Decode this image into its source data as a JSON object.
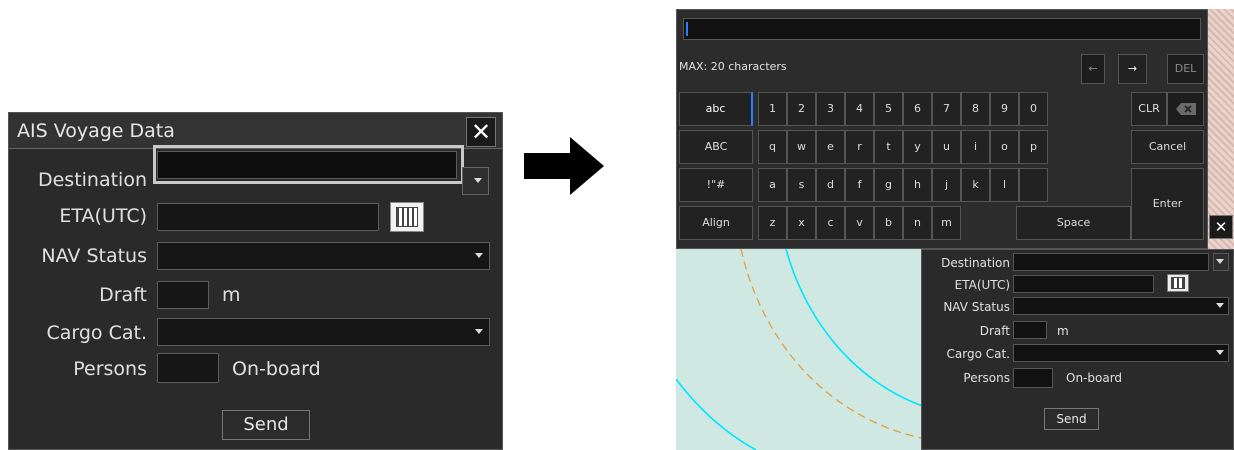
{
  "left_dialog": {
    "title": "AIS Voyage Data",
    "close_icon": "close-icon",
    "labels": {
      "destination": "Destination",
      "eta": "ETA(UTC)",
      "nav_status": "NAV Status",
      "draft": "Draft",
      "cargo": "Cargo Cat.",
      "persons": "Persons"
    },
    "units": {
      "draft": "m",
      "persons": "On-board"
    },
    "send_label": "Send"
  },
  "keyboard": {
    "max_text": "MAX: 20 characters",
    "left_arrow": "←",
    "right_arrow": "→",
    "del": "DEL",
    "clr": "CLR",
    "backspace_icon": "backspace-icon",
    "mode_keys": [
      "abc",
      "ABC",
      "!\"#",
      "Align"
    ],
    "row1": [
      "1",
      "2",
      "3",
      "4",
      "5",
      "6",
      "7",
      "8",
      "9",
      "0"
    ],
    "row2": [
      "q",
      "w",
      "e",
      "r",
      "t",
      "y",
      "u",
      "i",
      "o",
      "p"
    ],
    "row3": [
      "a",
      "s",
      "d",
      "f",
      "g",
      "h",
      "j",
      "k",
      "l"
    ],
    "row4": [
      "z",
      "x",
      "c",
      "v",
      "b",
      "n",
      "m"
    ],
    "space": "Space",
    "cancel": "Cancel",
    "enter": "Enter"
  },
  "right_panel": {
    "labels": {
      "destination": "Destination",
      "eta": "ETA(UTC)",
      "nav_status": "NAV Status",
      "draft": "Draft",
      "cargo": "Cargo Cat.",
      "persons": "Persons"
    },
    "units": {
      "draft": "m",
      "persons": "On-board"
    },
    "send_label": "Send",
    "close_icon": "close-icon"
  },
  "colors": {
    "accent": "#2b7fff",
    "chart_water": "#cfe8e2",
    "contour_cyan": "#00e5ff",
    "contour_orange": "#e0a040"
  }
}
